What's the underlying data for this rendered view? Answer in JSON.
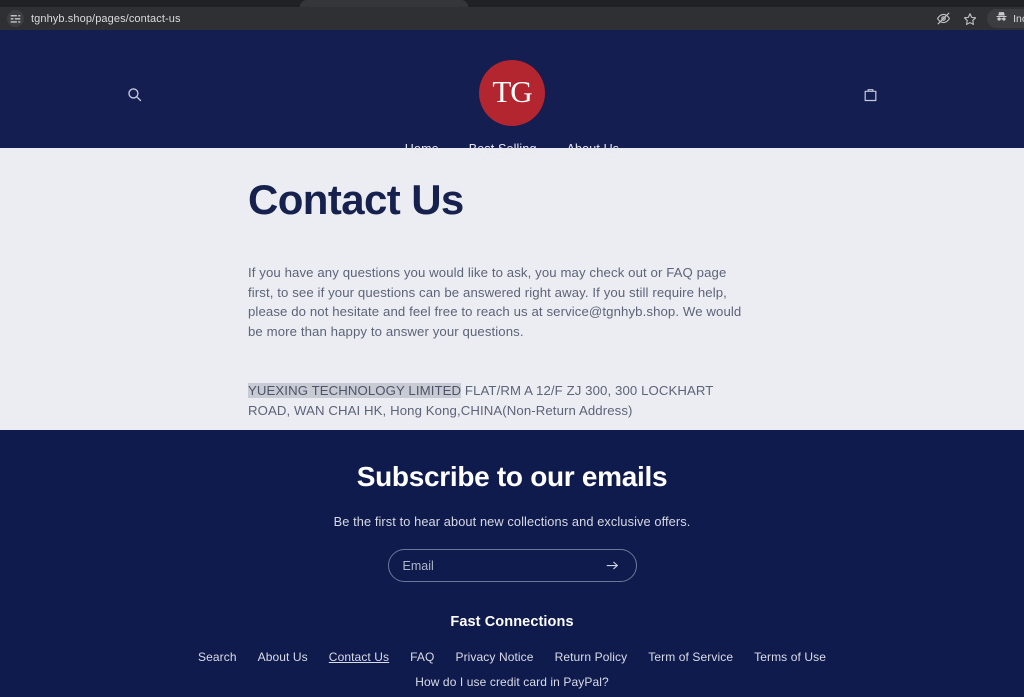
{
  "browser": {
    "url": "tgnhyb.shop/pages/contact-us",
    "url_chip_icon": "tune-sliders-icon",
    "tracking_protection_icon": "eye-slash-icon",
    "bookmark_icon": "star-icon",
    "incognito_label": "Inco",
    "incognito_icon": "incognito-hat-icon"
  },
  "header": {
    "search_icon": "search-icon",
    "cart_icon": "shopping-bag-icon",
    "logo_text": "TG",
    "logo_color": "#b3252f",
    "background_color": "#141e50",
    "nav": [
      {
        "label": "Home"
      },
      {
        "label": "Best Selling"
      },
      {
        "label": "About Us"
      }
    ]
  },
  "main": {
    "background_color": "#ecedf2",
    "title": "Contact Us",
    "title_color": "#17214e",
    "intro_paragraph": "If you have any questions you would like to ask, you may check out or FAQ page first, to see if your questions can be answered right away. If you still require help, please do not hesitate and feel free to reach us at service@tgnhyb.shop. We would be more than happy to answer your questions.",
    "address": {
      "selected_text": "YUEXING TECHNOLOGY LIMITED",
      "rest_text": " FLAT/RM A 12/F ZJ 300, 300 LOCKHART ROAD, WAN CHAI HK, Hong Kong,CHINA(Non-Return Address)",
      "selection_color": "#c8cbd4"
    }
  },
  "footer": {
    "background_color": "#101b4d",
    "subscribe_heading": "Subscribe to our emails",
    "subscribe_subtext": "Be the first to hear about new collections and exclusive offers.",
    "email_placeholder": "Email",
    "email_value": "",
    "submit_icon": "arrow-right-icon",
    "connections_heading": "Fast Connections",
    "links": [
      {
        "label": "Search",
        "active": false
      },
      {
        "label": "About Us",
        "active": false
      },
      {
        "label": "Contact Us",
        "active": true
      },
      {
        "label": "FAQ",
        "active": false
      },
      {
        "label": "Privacy Notice",
        "active": false
      },
      {
        "label": "Return Policy",
        "active": false
      },
      {
        "label": "Term of Service",
        "active": false
      },
      {
        "label": "Terms of Use",
        "active": false
      }
    ],
    "paypal_link": "How do I use credit card in PayPal?"
  }
}
